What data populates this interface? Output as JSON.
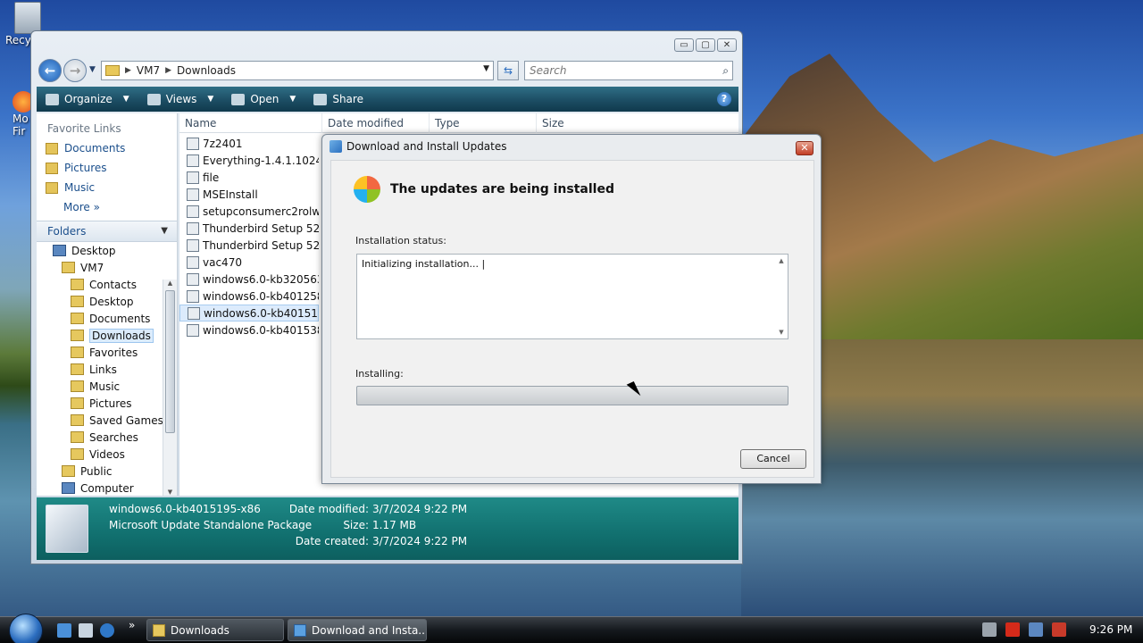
{
  "desktop": {
    "recycle_label": "Recy",
    "firefox_label": "Mo\nFir"
  },
  "explorer": {
    "window_controls": [
      "▭",
      "▢",
      "✕"
    ],
    "address": {
      "root": "VM7",
      "current": "Downloads"
    },
    "search_placeholder": "Search",
    "toolbar": {
      "organize": "Organize",
      "views": "Views",
      "open": "Open",
      "share": "Share",
      "help": "?"
    },
    "favorite_links": {
      "header": "Favorite Links",
      "items": [
        "Documents",
        "Pictures",
        "Music"
      ],
      "more": "More"
    },
    "folders": {
      "header": "Folders",
      "tree": [
        {
          "label": "Desktop",
          "indent": 1
        },
        {
          "label": "VM7",
          "indent": 2
        },
        {
          "label": "Contacts",
          "indent": 3
        },
        {
          "label": "Desktop",
          "indent": 3
        },
        {
          "label": "Documents",
          "indent": 3
        },
        {
          "label": "Downloads",
          "indent": 3,
          "selected": true
        },
        {
          "label": "Favorites",
          "indent": 3
        },
        {
          "label": "Links",
          "indent": 3
        },
        {
          "label": "Music",
          "indent": 3
        },
        {
          "label": "Pictures",
          "indent": 3
        },
        {
          "label": "Saved Games",
          "indent": 3
        },
        {
          "label": "Searches",
          "indent": 3
        },
        {
          "label": "Videos",
          "indent": 3
        },
        {
          "label": "Public",
          "indent": 2
        },
        {
          "label": "Computer",
          "indent": 2
        }
      ]
    },
    "columns": [
      "Name",
      "Date modified",
      "Type",
      "Size"
    ],
    "files": [
      {
        "name": "7z2401"
      },
      {
        "name": "Everything-1.4.1.1024.x..."
      },
      {
        "name": "file"
      },
      {
        "name": "MSEInstall"
      },
      {
        "name": "setupconsumerc2rolw"
      },
      {
        "name": "Thunderbird Setup 52...."
      },
      {
        "name": "Thunderbird Setup 52...."
      },
      {
        "name": "vac470"
      },
      {
        "name": "windows6.0-kb320563..."
      },
      {
        "name": "windows6.0-kb401258..."
      },
      {
        "name": "windows6.0-kb401519...",
        "selected": true
      },
      {
        "name": "windows6.0-kb401538..."
      }
    ],
    "details": {
      "name": "windows6.0-kb4015195-x86",
      "type": "Microsoft Update Standalone Package",
      "date_modified_label": "Date modified:",
      "date_modified": "3/7/2024 9:22 PM",
      "size_label": "Size:",
      "size": "1.17 MB",
      "date_created_label": "Date created:",
      "date_created": "3/7/2024 9:22 PM"
    }
  },
  "dialog": {
    "title": "Download and Install Updates",
    "close": "✕",
    "heading": "The updates are being installed",
    "status_label": "Installation status:",
    "status_text": "Initializing installation... |",
    "installing_label": "Installing:",
    "progress": 0,
    "cancel": "Cancel"
  },
  "taskbar": {
    "buttons": [
      {
        "label": "Downloads"
      },
      {
        "label": "Download and Insta..."
      }
    ],
    "overflow": "»",
    "clock": "9:26 PM"
  }
}
